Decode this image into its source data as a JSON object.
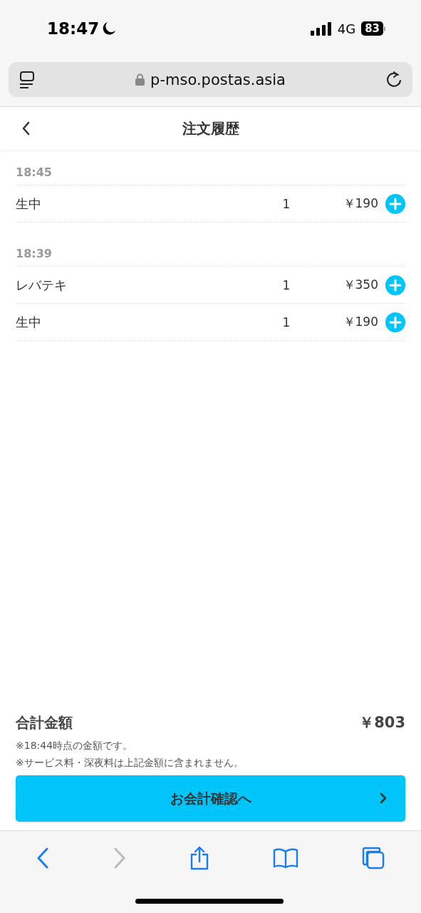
{
  "status_bar": {
    "time": "18:47",
    "network": "4G",
    "battery": "83"
  },
  "browser": {
    "url": "p-mso.postas.asia"
  },
  "header": {
    "title": "注文履歴"
  },
  "orders": [
    {
      "time": "18:45",
      "items": [
        {
          "name": "生中",
          "qty": "1",
          "price": "￥190"
        }
      ]
    },
    {
      "time": "18:39",
      "items": [
        {
          "name": "レバテキ",
          "qty": "1",
          "price": "￥350"
        },
        {
          "name": "生中",
          "qty": "1",
          "price": "￥190"
        }
      ]
    }
  ],
  "total": {
    "label": "合計金額",
    "amount": "￥803",
    "notes": [
      "※18:44時点の金額です。",
      "※サービス料・深夜料は上記金額に含まれません。"
    ]
  },
  "checkout_button": "お会計確認へ",
  "toolbar": [
    {
      "kind": "back",
      "disabled": false
    },
    {
      "kind": "forward",
      "disabled": true
    },
    {
      "kind": "share",
      "disabled": false
    },
    {
      "kind": "bookmarks",
      "disabled": false
    },
    {
      "kind": "tabs",
      "disabled": false
    }
  ]
}
